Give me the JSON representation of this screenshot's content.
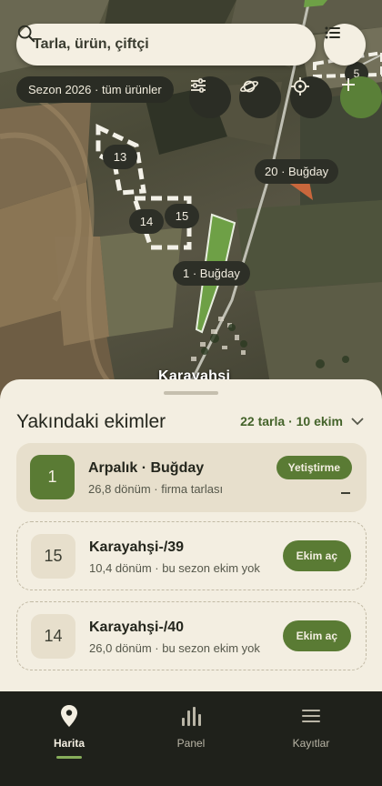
{
  "search": {
    "placeholder": "Tarla, ürün, çiftçi"
  },
  "season_chip": "Sezon 2026 · tüm ürünler",
  "map": {
    "labels": {
      "f13": "13",
      "f20": "20 · Buğday",
      "f14": "14",
      "f15": "15",
      "f1": "1 · Buğday",
      "f5": "5"
    },
    "town": "Karayahşi"
  },
  "sheet": {
    "title": "Yakındaki ekimler",
    "summary": "22 tarla · 10 ekim",
    "cards": [
      {
        "num": "1",
        "title": "Arpalık · Buğday",
        "sub": "26,8 dönüm · firma tarlası",
        "action": "Yetiştirme"
      },
      {
        "num": "15",
        "title": "Karayahşi-/39",
        "sub": "10,4 dönüm · bu sezon ekim yok",
        "action": "Ekim aç"
      },
      {
        "num": "14",
        "title": "Karayahşi-/40",
        "sub": "26,0 dönüm · bu sezon ekim yok",
        "action": "Ekim aç"
      }
    ]
  },
  "nav": {
    "items": [
      {
        "label": "Harita",
        "icon": "map-pin-icon",
        "active": true
      },
      {
        "label": "Panel",
        "icon": "bar-chart-icon",
        "active": false
      },
      {
        "label": "Kayıtlar",
        "icon": "menu-lines-icon",
        "active": false
      }
    ]
  },
  "colors": {
    "accent": "#5a7b34",
    "surface": "#f3eee1",
    "dark": "#1f211b",
    "nav_indicator": "#86ad5a"
  }
}
